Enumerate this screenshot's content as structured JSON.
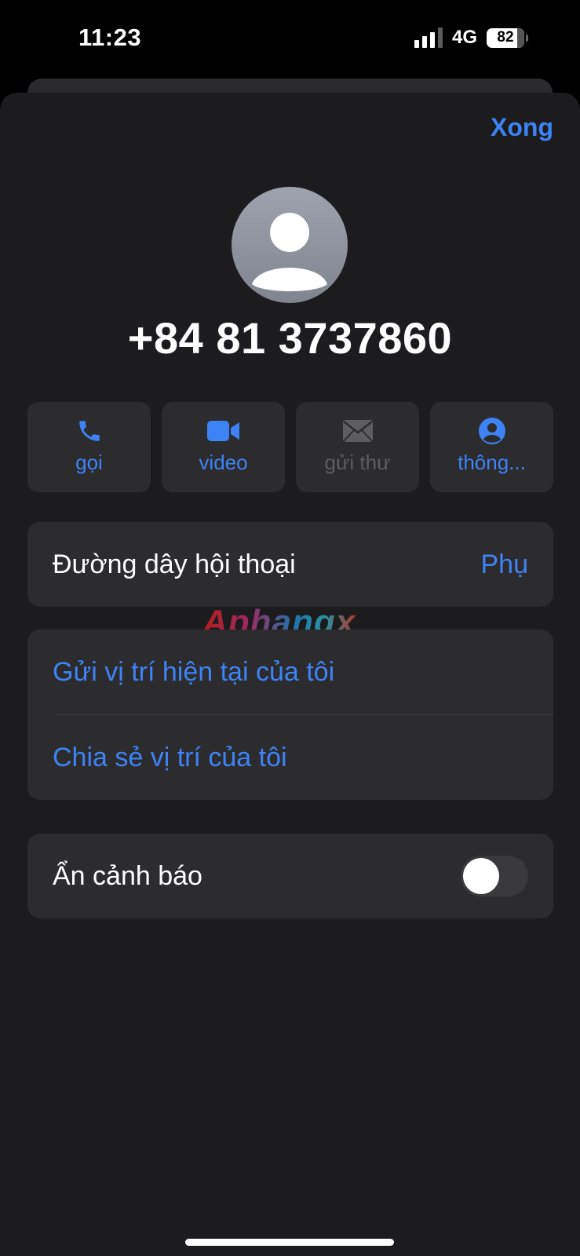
{
  "status_bar": {
    "time": "11:23",
    "network": "4G",
    "battery_level": "82",
    "battery_fraction": 0.82,
    "signal_icon": "cellular-signal-icon"
  },
  "header": {
    "done_label": "Xong"
  },
  "contact": {
    "avatar_icon": "person-silhouette-icon",
    "name": "+84 81 3737860"
  },
  "actions": [
    {
      "label": "gọi",
      "icon": "phone-icon",
      "enabled": true
    },
    {
      "label": "video",
      "icon": "video-camera-icon",
      "enabled": true
    },
    {
      "label": "gửi thư",
      "icon": "envelope-icon",
      "enabled": false
    },
    {
      "label": "thông...",
      "icon": "person-circle-icon",
      "enabled": true
    }
  ],
  "conversation_line": {
    "label": "Đường dây hội thoại",
    "value": "Phụ"
  },
  "location": {
    "send_current": "Gửi vị trí hiện tại của tôi",
    "share": "Chia sẻ vị trí của tôi"
  },
  "alerts": {
    "label": "Ẩn cảnh báo",
    "enabled": false
  },
  "watermark": "Aphangx",
  "colors": {
    "accent": "#3d83f5",
    "background": "#1c1c1e",
    "card": "#2c2c2e",
    "disabled": "#5e5e62"
  }
}
